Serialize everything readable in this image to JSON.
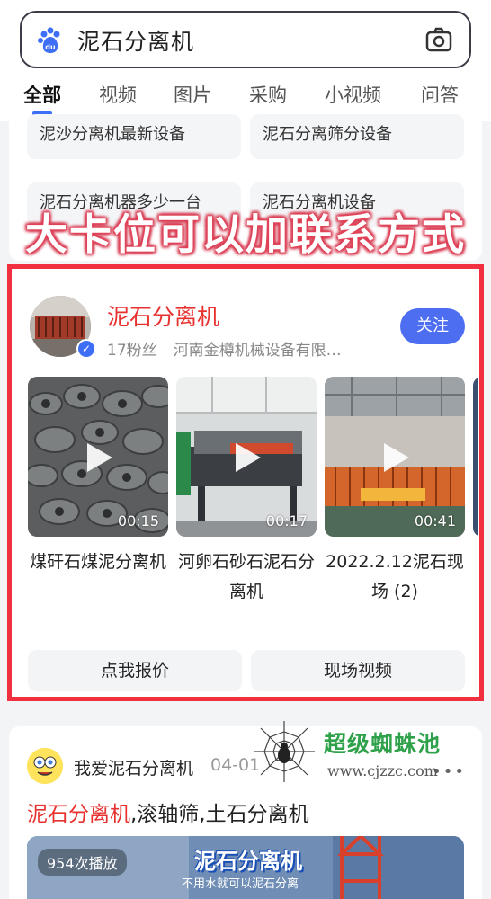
{
  "search": {
    "query": "泥石分离机"
  },
  "tabs": [
    {
      "label": "全部"
    },
    {
      "label": "视频"
    },
    {
      "label": "图片"
    },
    {
      "label": "采购"
    },
    {
      "label": "小视频"
    },
    {
      "label": "问答"
    }
  ],
  "related_searches": [
    {
      "label": "泥沙分离机最新设备"
    },
    {
      "label": "泥石分离筛分设备"
    },
    {
      "label": "泥石分离机器多少一台"
    },
    {
      "label": "泥石分离机设备"
    }
  ],
  "overlay_annotation": "大卡位可以加联系方式",
  "profile_card": {
    "name": "泥石分离机",
    "followers": "17粉丝",
    "company": "河南金樽机械设备有限…",
    "follow_label": "关注",
    "videos": [
      {
        "title": "煤矸石煤泥分离机",
        "duration": "00:15"
      },
      {
        "title": "河卵石砂石泥石分离机",
        "duration": "00:17"
      },
      {
        "title": "2022.2.12泥石现场 (2)",
        "duration": "00:41"
      }
    ],
    "actions": [
      {
        "label": "点我报价"
      },
      {
        "label": "现场视频"
      }
    ]
  },
  "result": {
    "author": "我爱泥石分离机",
    "date": "04-01",
    "title_highlight": "泥石分离机",
    "title_rest": ",滚轴筛,土石分离机",
    "play_count": "954次播放",
    "thumb_brand": "泥石分离机",
    "thumb_caption": "不用水就可以泥石分离"
  },
  "watermark": {
    "title": "超级蜘蛛池",
    "url": "www.cjzzc.com"
  },
  "colors": {
    "accent_blue": "#4e6ef2",
    "highlight_red": "#e8322f",
    "frame_red": "#f0303f"
  }
}
